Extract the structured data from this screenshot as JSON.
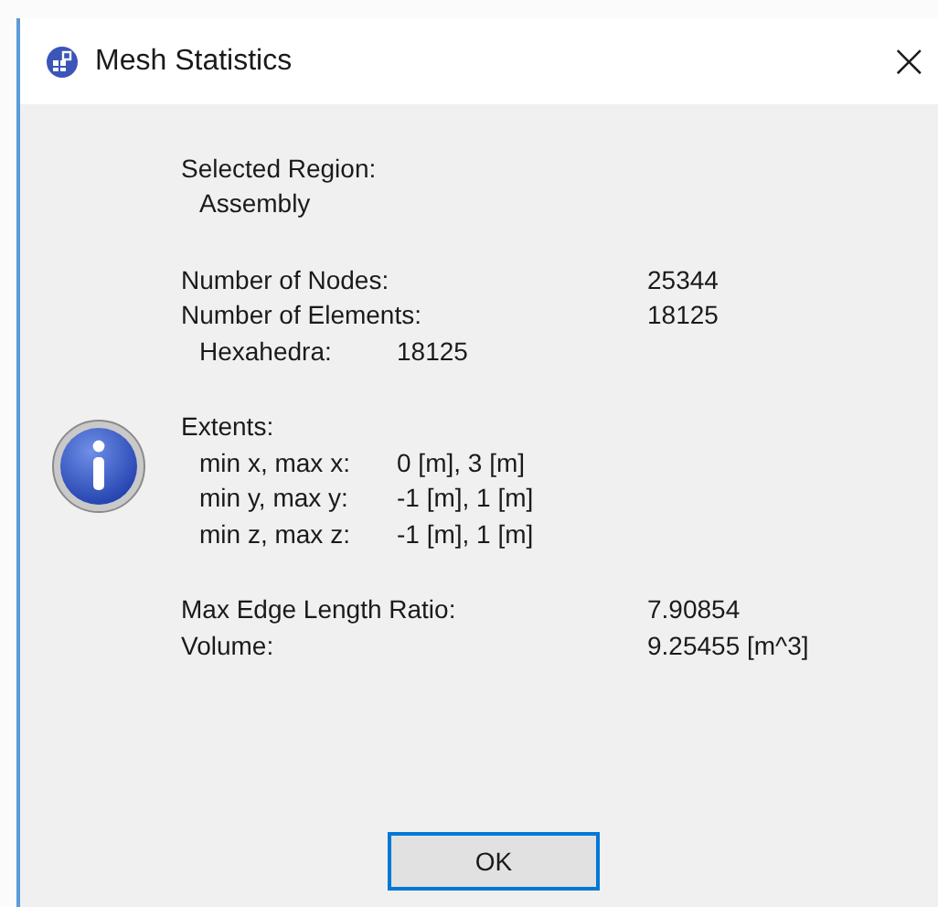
{
  "window": {
    "title": "Mesh Statistics",
    "close": "×"
  },
  "sections": [
    {
      "rows": [
        {
          "kind": "main",
          "label": "Selected Region:"
        },
        {
          "kind": "indented",
          "label": "Assembly"
        }
      ]
    },
    {
      "rows": [
        {
          "kind": "main",
          "label": "Number of Nodes:",
          "value": "25344"
        },
        {
          "kind": "main",
          "label": "Number of Elements:",
          "value": "18125"
        },
        {
          "kind": "indented",
          "label": "Hexahedra:",
          "value": "18125"
        }
      ]
    },
    {
      "rows": [
        {
          "kind": "main",
          "label": "Extents:"
        },
        {
          "kind": "indented",
          "label": "min x, max x:",
          "value": "0 [m], 3 [m]"
        },
        {
          "kind": "indented",
          "label": "min y, max y:",
          "value": "-1 [m], 1 [m]"
        },
        {
          "kind": "indented",
          "label": "min z, max z:",
          "value": "-1 [m], 1 [m]"
        }
      ]
    },
    {
      "rows": [
        {
          "kind": "main",
          "label": "Max Edge Length Ratio:",
          "value": "7.90854"
        },
        {
          "kind": "main",
          "label": "Volume:",
          "value": "9.25455 [m^3]"
        }
      ]
    }
  ],
  "buttons": [
    "OK"
  ]
}
